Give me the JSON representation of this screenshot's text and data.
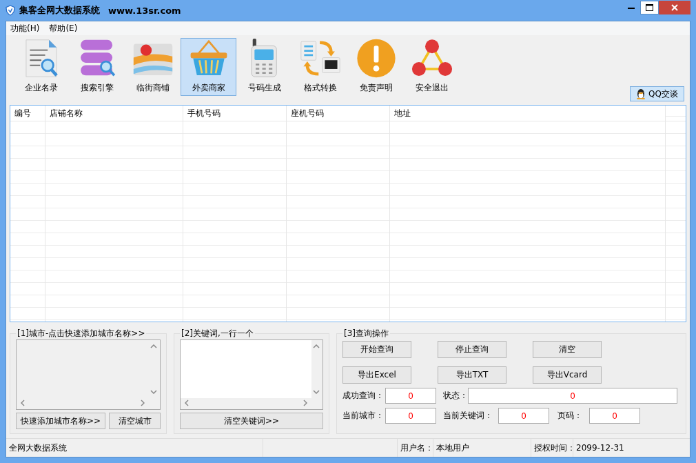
{
  "window": {
    "title": "集客全网大数据系统",
    "url": "www.13sr.com"
  },
  "menu": [
    "功能(H)",
    "帮助(E)"
  ],
  "toolbar": [
    {
      "label": "企业名录",
      "kind": "document",
      "selected": false
    },
    {
      "label": "搜索引擎",
      "kind": "database",
      "selected": false
    },
    {
      "label": "临街商铺",
      "kind": "map",
      "selected": false
    },
    {
      "label": "外卖商家",
      "kind": "basket",
      "selected": true
    },
    {
      "label": "号码生成",
      "kind": "phone",
      "selected": false
    },
    {
      "label": "格式转换",
      "kind": "convert",
      "selected": false
    },
    {
      "label": "免责声明",
      "kind": "warning",
      "selected": false
    },
    {
      "label": "安全退出",
      "kind": "exit",
      "selected": false
    }
  ],
  "qq_button": "QQ交谈",
  "table": {
    "columns": [
      "编号",
      "店铺名称",
      "手机号码",
      "座机号码",
      "地址"
    ]
  },
  "city_panel": {
    "title": "[1]城市-点击快速添加城市名称>>",
    "buttons": [
      "快速添加城市名称>>",
      "清空城市"
    ]
  },
  "keyword_panel": {
    "title": "[2]关键词,一行一个",
    "button": "清空关键词>>"
  },
  "query_panel": {
    "title": "[3]查询操作",
    "buttons": [
      "开始查询",
      "停止查询",
      "清空",
      "导出Excel",
      "导出TXT",
      "导出Vcard"
    ],
    "success_label": "成功查询：",
    "success_value": "0",
    "status_label": "状态：",
    "status_value": "0",
    "city_label": "当前城市：",
    "city_value": "0",
    "keyword_label": "当前关键词：",
    "keyword_value": "0",
    "page_label": "页码：",
    "page_value": "0"
  },
  "status_bar": {
    "app": "全网大数据系统",
    "user_label": "用户名：",
    "user": "本地用户",
    "license_label": "授权时间：",
    "license": "2099-12-31"
  }
}
